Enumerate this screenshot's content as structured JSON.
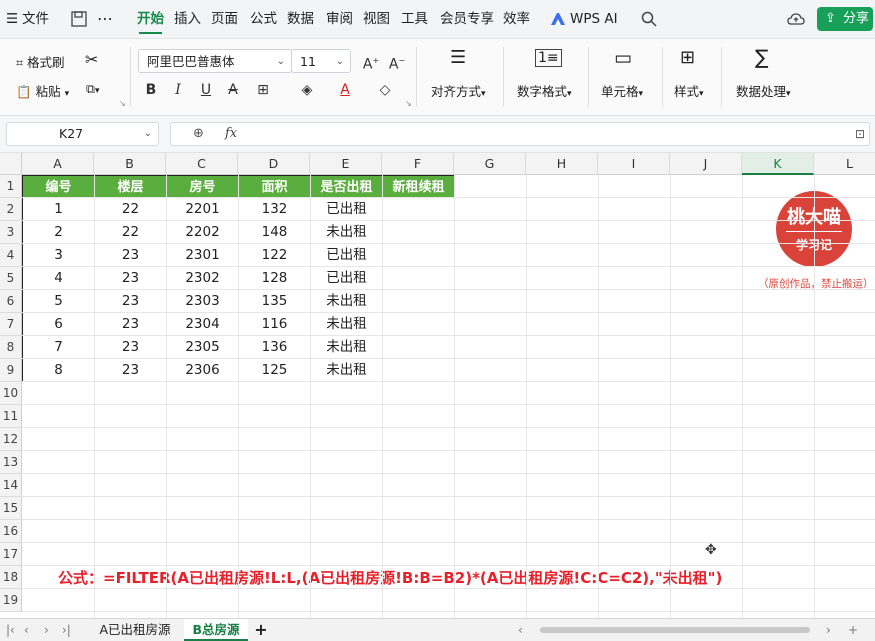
{
  "menu": {
    "file_label": "文件",
    "tabs": [
      "开始",
      "插入",
      "页面",
      "公式",
      "数据",
      "审阅",
      "视图",
      "工具",
      "会员专享",
      "效率"
    ],
    "active_tab": "开始",
    "ai_label": "WPS AI",
    "share_label": "分享"
  },
  "ribbon": {
    "format_painter": "格式刷",
    "paste": "粘贴",
    "font_name": "阿里巴巴普惠体",
    "font_size": "11",
    "align": "对齐方式",
    "number_format": "数字格式",
    "cells": "单元格",
    "styles": "样式",
    "data_processing": "数据处理"
  },
  "formula_bar": {
    "cell_ref": "K27",
    "fx": "fx",
    "content": ""
  },
  "columns": [
    "A",
    "B",
    "C",
    "D",
    "E",
    "F",
    "G",
    "H",
    "I",
    "J",
    "K",
    "L"
  ],
  "selected_column": "K",
  "rows": [
    "1",
    "2",
    "3",
    "4",
    "5",
    "6",
    "7",
    "8",
    "9",
    "10",
    "11",
    "12",
    "13",
    "14",
    "15",
    "16",
    "17",
    "18",
    "19"
  ],
  "table": {
    "headers": [
      "编号",
      "楼层",
      "房号",
      "面积",
      "是否出租",
      "新租续租"
    ],
    "rows": [
      [
        "1",
        "22",
        "2201",
        "132",
        "已出租",
        ""
      ],
      [
        "2",
        "22",
        "2202",
        "148",
        "未出租",
        ""
      ],
      [
        "3",
        "23",
        "2301",
        "122",
        "已出租",
        ""
      ],
      [
        "4",
        "23",
        "2302",
        "128",
        "已出租",
        ""
      ],
      [
        "5",
        "23",
        "2303",
        "135",
        "未出租",
        ""
      ],
      [
        "6",
        "23",
        "2304",
        "116",
        "未出租",
        ""
      ],
      [
        "7",
        "23",
        "2305",
        "136",
        "未出租",
        ""
      ],
      [
        "8",
        "23",
        "2306",
        "125",
        "未出租",
        ""
      ]
    ]
  },
  "formula_note": "公式：=FILTER(A已出租房源!L:L,(A已出租房源!B:B=B2)*(A已出租房源!C:C=C2),\"未出租\")",
  "seal": {
    "title": "桃大喵",
    "subtitle": "学习记",
    "caption": "（原创作品，禁止搬运）"
  },
  "sheet_tabs": [
    "A已出租房源",
    "B总房源"
  ],
  "active_sheet": "B总房源",
  "colors": {
    "accent": "#1a7f45",
    "header_fill": "#5aae3d",
    "formula_note": "#e8202a",
    "seal": "#d9433a"
  }
}
